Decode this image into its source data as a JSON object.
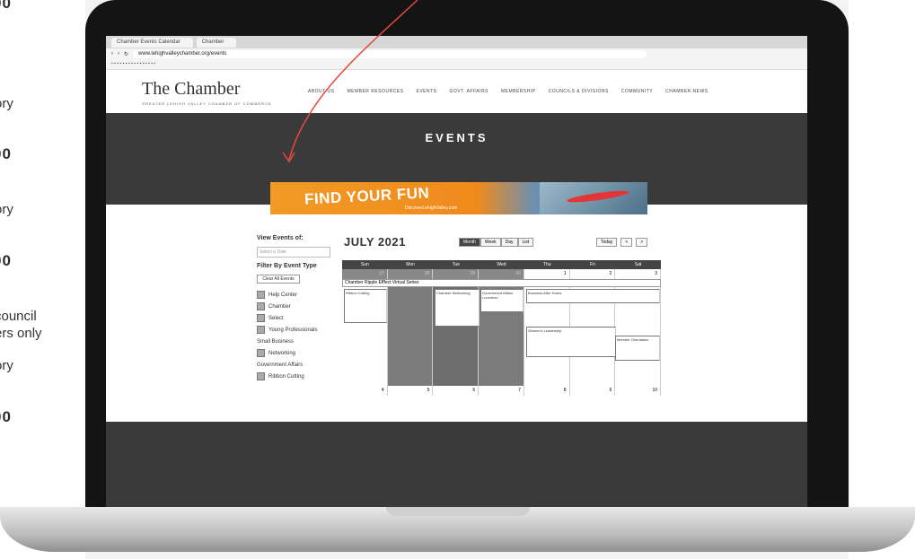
{
  "side": {
    "amounts": [
      "00",
      "00",
      "00",
      "00"
    ],
    "labels": [
      "ory",
      "ory",
      "council",
      "ers only",
      "ory"
    ]
  },
  "browser": {
    "tabs": [
      "Chamber Events Calendar",
      "Chamber"
    ],
    "url": "www.lehighvalleychamber.org/events"
  },
  "site": {
    "logo": "The Chamber",
    "logo_sub": "GREATER LEHIGH VALLEY CHAMBER OF COMMERCE",
    "nav": [
      "ABOUT US",
      "MEMBER RESOURCES",
      "EVENTS",
      "GOVT. AFFAIRS",
      "MEMBERSHIP",
      "COUNCILS & DIVISIONS",
      "COMMUNITY",
      "CHAMBER NEWS"
    ],
    "page_title": "EVENTS",
    "banner_text": "FIND YOUR FUN",
    "banner_sub": "DiscoverLehighValley.com"
  },
  "filters": {
    "title": "View Events of:",
    "date_placeholder": "Select a Date",
    "type_title": "Filter By Event Type",
    "clear_label": "Clear All Events",
    "items": [
      "Help Center",
      "Chamber",
      "Select",
      "Young Professionals",
      "Small Business",
      "Networking",
      "Government Affairs",
      "Ribbon Cutting"
    ]
  },
  "calendar": {
    "month": "JULY 2021",
    "views": [
      "Month",
      "Week",
      "Day",
      "List"
    ],
    "nav": [
      "Today",
      "<",
      ">"
    ],
    "days": [
      "Sun",
      "Mon",
      "Tue",
      "Wed",
      "Thu",
      "Fri",
      "Sat"
    ],
    "week1": [
      "27",
      "28",
      "29",
      "30",
      "1",
      "2",
      "3"
    ],
    "week2": [
      "4",
      "5",
      "6",
      "7",
      "8",
      "9",
      "10"
    ],
    "banner_event": "Chamber Ripple Efffect Virtual Series",
    "events": [
      "Ribbon Cutting",
      "Chamber Networking",
      "Government Affairs Luncheon",
      "Business After Hours",
      "Women's Leadership",
      "Member Orientation"
    ]
  }
}
